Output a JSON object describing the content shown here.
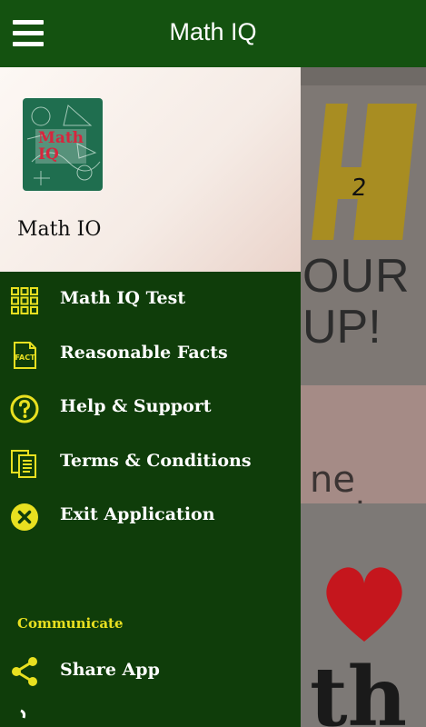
{
  "appbar": {
    "title": "Math IQ",
    "menu_icon": "hamburger-menu-icon"
  },
  "drawer": {
    "header": {
      "logo_text_line1": "Math",
      "logo_text_line2": "IQ",
      "app_name": "Math IO"
    },
    "items": [
      {
        "label": "Math IQ Test",
        "icon": "grid-icon"
      },
      {
        "label": "Reasonable Facts",
        "icon": "fact-document-icon"
      },
      {
        "label": "Help & Support",
        "icon": "question-circle-icon"
      },
      {
        "label": "Terms & Conditions",
        "icon": "documents-icon"
      },
      {
        "label": "Exit Application",
        "icon": "close-circle-icon"
      }
    ],
    "section_communicate": "Communicate",
    "share": {
      "label": "Share App",
      "icon": "share-icon"
    }
  },
  "colors": {
    "appbar": "#145210",
    "drawer": "#0f3d0a",
    "icon_accent": "#e8e020",
    "text": "#ffffff"
  }
}
